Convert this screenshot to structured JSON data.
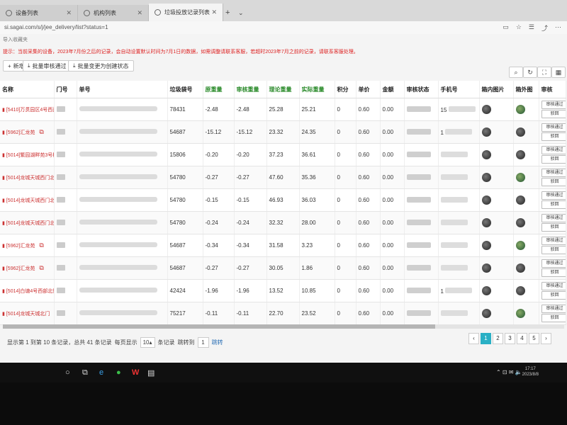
{
  "browser": {
    "tabs": [
      {
        "label": "设备列表"
      },
      {
        "label": "机构列表"
      },
      {
        "label": "垃圾投放记录列表"
      }
    ],
    "url": "si.sagai.com/s/j/jee_delivery/list?status=1",
    "bookmark": "导入收藏夹",
    "notice": "提示：当前采集的设备，2023年7月份之后的记录，会自动设置默认时间为7月1日的数据，如需调整请联系客服，若超时2023年7月之前的记录，请联系客服处理。"
  },
  "toolbar": {
    "new_label": "新增",
    "batch_audit_label": "批量审核通过",
    "batch_change_label": "批量变更为创建状态"
  },
  "table": {
    "columns": [
      "名称",
      "门号",
      "单号",
      "垃圾袋号",
      "原重量",
      "审核重量",
      "理论重量",
      "实际重量",
      "积分",
      "单价",
      "金额",
      "审核状态",
      "手机号",
      "箱内图片",
      "箱外图",
      "审核"
    ],
    "audit_pass_label": "审核通过",
    "audit_reject_label": "驳回",
    "rows": [
      {
        "name": "[5410]万贯园区4号西面",
        "bag": "78431",
        "orig": "-2.48",
        "audit": "-2.48",
        "theory": "25.28",
        "actual": "25.21",
        "points": "0",
        "price": "0.60",
        "amount": "0.00",
        "phone": "15"
      },
      {
        "name": "[5962]汇龙苑",
        "bag": "54687",
        "orig": "-15.12",
        "audit": "-15.12",
        "theory": "23.32",
        "actual": "24.35",
        "points": "0",
        "price": "0.60",
        "amount": "0.00",
        "phone": "1"
      },
      {
        "name": "[5014]繁园湖畔苑3号楼旁",
        "bag": "15806",
        "orig": "-0.20",
        "audit": "-0.20",
        "theory": "37.23",
        "actual": "36.61",
        "points": "0",
        "price": "0.60",
        "amount": "0.00",
        "phone": ""
      },
      {
        "name": "[5014]龙城天城西门北侧",
        "bag": "54780",
        "orig": "-0.27",
        "audit": "-0.27",
        "theory": "47.60",
        "actual": "35.36",
        "points": "0",
        "price": "0.60",
        "amount": "0.00",
        "phone": ""
      },
      {
        "name": "[5014]龙城天城西门北侧",
        "bag": "54780",
        "orig": "-0.15",
        "audit": "-0.15",
        "theory": "46.93",
        "actual": "36.03",
        "points": "0",
        "price": "0.60",
        "amount": "0.00",
        "phone": ""
      },
      {
        "name": "[5014]龙城天城西门北侧",
        "bag": "54780",
        "orig": "-0.24",
        "audit": "-0.24",
        "theory": "32.32",
        "actual": "28.00",
        "points": "0",
        "price": "0.60",
        "amount": "0.00",
        "phone": ""
      },
      {
        "name": "[5962]汇龙苑",
        "bag": "54687",
        "orig": "-0.34",
        "audit": "-0.34",
        "theory": "31.58",
        "actual": "3.23",
        "points": "0",
        "price": "0.60",
        "amount": "0.00",
        "phone": ""
      },
      {
        "name": "[5962]汇龙苑",
        "bag": "54687",
        "orig": "-0.27",
        "audit": "-0.27",
        "theory": "30.05",
        "actual": "1.86",
        "points": "0",
        "price": "0.60",
        "amount": "0.00",
        "phone": ""
      },
      {
        "name": "[5014]白塘4号西部北侧",
        "bag": "42424",
        "orig": "-1.96",
        "audit": "-1.96",
        "theory": "13.52",
        "actual": "10.85",
        "points": "0",
        "price": "0.60",
        "amount": "0.00",
        "phone": "1"
      },
      {
        "name": "[5014]龙城天城北门",
        "bag": "75217",
        "orig": "-0.11",
        "audit": "-0.11",
        "theory": "22.70",
        "actual": "23.52",
        "points": "0",
        "price": "0.60",
        "amount": "0.00",
        "phone": ""
      }
    ]
  },
  "pagination": {
    "summary": "显示第 1 到第 10 条记录，总共 41 条记录",
    "per_page_label": "每页显示",
    "per_page_value": "10",
    "per_page_suffix": "条记录",
    "jump_label": "跳转到",
    "jump_value": "1",
    "jump_button": "跳转",
    "pages": [
      "1",
      "2",
      "3",
      "4",
      "5"
    ],
    "current": "1"
  },
  "taskbar": {
    "time": "17:17",
    "date": "2023/8/8"
  }
}
